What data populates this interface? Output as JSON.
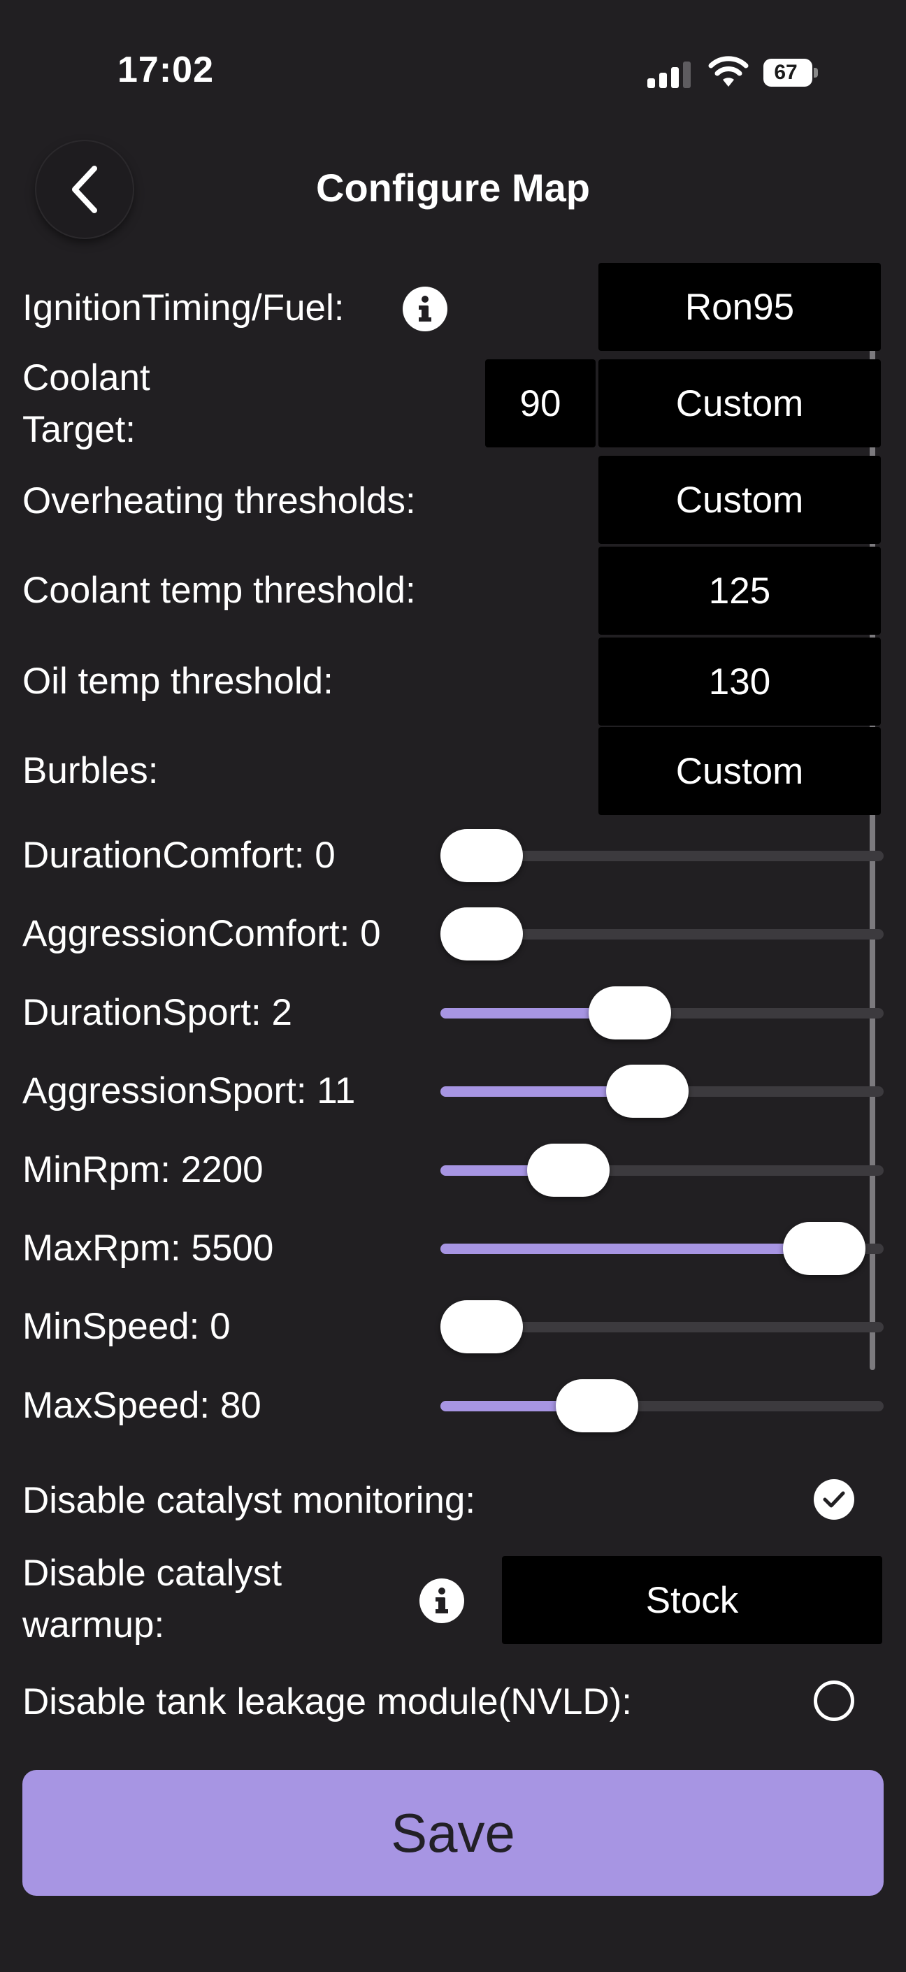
{
  "status_bar": {
    "time": "17:02",
    "battery": "67"
  },
  "header": {
    "title": "Configure Map"
  },
  "settings": {
    "ignition": {
      "label": "IgnitionTiming/Fuel:",
      "value": "Ron95"
    },
    "coolant_target": {
      "label_line1": "Coolant",
      "label_line2": "Target:",
      "number": "90",
      "value": "Custom"
    },
    "overheating": {
      "label": "Overheating thresholds:",
      "value": "Custom"
    },
    "coolant_temp": {
      "label": "Coolant temp threshold:",
      "value": "125"
    },
    "oil_temp": {
      "label": "Oil temp threshold:",
      "value": "130"
    },
    "burbles": {
      "label": "Burbles:",
      "value": "Custom"
    }
  },
  "sliders": [
    {
      "label": "DurationComfort: 0",
      "fraction": 0.0
    },
    {
      "label": "AggressionComfort: 0",
      "fraction": 0.0
    },
    {
      "label": "DurationSport: 2",
      "fraction": 0.41
    },
    {
      "label": "AggressionSport: 11",
      "fraction": 0.46
    },
    {
      "label": "MinRpm: 2200",
      "fraction": 0.24
    },
    {
      "label": "MaxRpm: 5500",
      "fraction": 0.95
    },
    {
      "label": "MinSpeed: 0",
      "fraction": 0.0
    },
    {
      "label": "MaxSpeed: 80",
      "fraction": 0.32
    }
  ],
  "toggles": {
    "catalyst_monitoring": {
      "label": "Disable catalyst monitoring:",
      "checked": true
    },
    "catalyst_warmup": {
      "label_line1": "Disable catalyst",
      "label_line2": "warmup:",
      "value": "Stock"
    },
    "tank_leakage": {
      "label": "Disable tank leakage module(NVLD):",
      "checked": false
    }
  },
  "actions": {
    "save_label": "Save"
  },
  "colors": {
    "accent": "#a795e3",
    "background": "#211f22",
    "track": "#3c3a3e",
    "box": "#000000"
  }
}
